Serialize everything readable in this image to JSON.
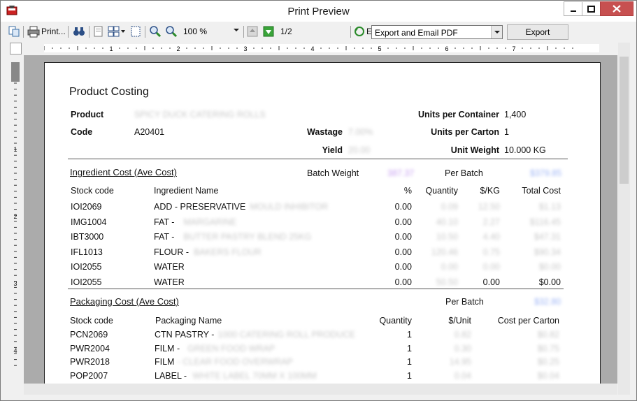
{
  "window": {
    "title": "Print Preview"
  },
  "toolbar": {
    "print_label": "Print...",
    "zoom_value": "100 %",
    "page_indicator": "1/2",
    "email_label": "E",
    "export_option": "Export and Email PDF",
    "export_button": "Export"
  },
  "ruler": {
    "marks": [
      "1",
      "2",
      "3",
      "4",
      "5",
      "6",
      "7"
    ],
    "vmarks": [
      "1",
      "2",
      "3",
      "4"
    ]
  },
  "report": {
    "title": "Product Costing",
    "product_label": "Product",
    "product_value": "SPICY DUCK CATERING ROLLS",
    "code_label": "Code",
    "code_value": "A20401",
    "wastage_label": "Wastage",
    "wastage_value": "7.00%",
    "yield_label": "Yield",
    "yield_value": "20.00",
    "units_container_label": "Units per Container",
    "units_container_value": "1,400",
    "units_carton_label": "Units per Carton",
    "units_carton_value": "1",
    "unit_weight_label": "Unit Weight",
    "unit_weight_value": "10.000 KG",
    "ingredient_section": {
      "title": "Ingredient Cost (Ave Cost)",
      "batch_weight_label": "Batch Weight",
      "batch_weight_value": "387.37",
      "per_batch_label": "Per Batch",
      "per_batch_value": "$379.85",
      "headers": {
        "stock_code": "Stock code",
        "name": "Ingredient Name",
        "pct": "%",
        "qty": "Quantity",
        "price": "$/KG",
        "total": "Total Cost"
      },
      "rows": [
        {
          "code": "IOI2069",
          "name": "ADD - PRESERVATIVE",
          "name_hidden": "MOULD INHIBITOR",
          "pct": "0.00",
          "qty": "0.09",
          "price": "12.50",
          "total": "$1.13"
        },
        {
          "code": "IMG1004",
          "name": "FAT -",
          "name_hidden": "MARGARINE",
          "pct": "0.00",
          "qty": "40.10",
          "price": "2.27",
          "total": "$116.45"
        },
        {
          "code": "IBT3000",
          "name": "FAT -",
          "name_hidden": "BUTTER PASTRY BLEND 25KG",
          "pct": "0.00",
          "qty": "10.50",
          "price": "4.40",
          "total": "$47.31"
        },
        {
          "code": "IFL1013",
          "name": "FLOUR -",
          "name_hidden": "BAKERS FLOUR",
          "pct": "0.00",
          "qty": "120.46",
          "price": "0.75",
          "total": "$90.34"
        },
        {
          "code": "IOI2055",
          "name": "WATER",
          "name_hidden": "",
          "pct": "0.00",
          "qty": "0.00",
          "price": "0.00",
          "total": "$0.00"
        },
        {
          "code": "IOI2055",
          "name": "WATER",
          "name_hidden": "",
          "pct": "0.00",
          "qty": "50.50",
          "price": "0.00",
          "total": "$0.00"
        }
      ]
    },
    "packaging_section": {
      "title": "Packaging Cost (Ave Cost)",
      "per_batch_label": "Per Batch",
      "per_batch_value": "$32.80",
      "headers": {
        "stock_code": "Stock code",
        "name": "Packaging Name",
        "qty": "Quantity",
        "price": "$/Unit",
        "total": "Cost per Carton"
      },
      "rows": [
        {
          "code": "PCN2069",
          "name": "CTN PASTRY -",
          "name_hidden": "1000 CATERING ROLL PRODUCE",
          "qty": "1",
          "price": "0.82",
          "total": "$0.82"
        },
        {
          "code": "PWR2004",
          "name": "FILM -",
          "name_hidden": "GREEN FOOD WRAP",
          "qty": "1",
          "price": "0.30",
          "total": "$0.75"
        },
        {
          "code": "PWR2018",
          "name": "FILM",
          "name_hidden": "- CLEAR FOOD OVERWRAP",
          "qty": "1",
          "price": "14.95",
          "total": "$0.25"
        },
        {
          "code": "POP2007",
          "name": "LABEL -",
          "name_hidden": "WHITE LABEL 70MM X 100MM",
          "qty": "1",
          "price": "0.04",
          "total": "$0.04"
        }
      ]
    }
  }
}
